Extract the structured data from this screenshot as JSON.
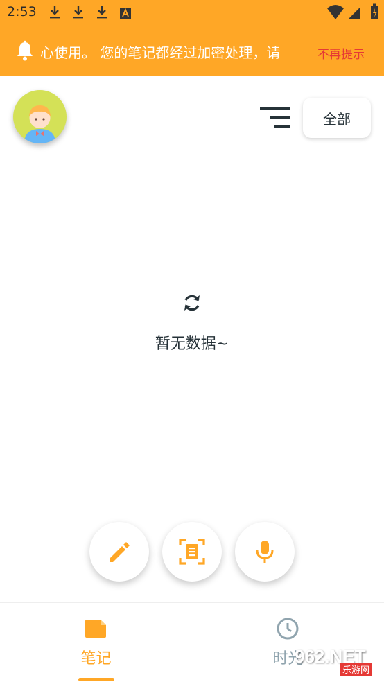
{
  "status_bar": {
    "time": "2:53",
    "icons": [
      "download-icon",
      "download-icon",
      "download-icon",
      "text-badge-icon",
      "wifi-icon",
      "signal-icon",
      "battery-icon"
    ]
  },
  "notice": {
    "text": "心使用。 您的笔记都经过加密处理，请",
    "dismiss": "不再提示",
    "icon": "bell-icon"
  },
  "header": {
    "avatar": "avatar",
    "menu_icon": "menu-icon",
    "filter_label": "全部"
  },
  "empty_state": {
    "icon": "refresh-icon",
    "text": "暂无数据~"
  },
  "fabs": [
    {
      "name": "edit",
      "icon": "pencil-icon"
    },
    {
      "name": "scan",
      "icon": "scan-icon"
    },
    {
      "name": "voice",
      "icon": "microphone-icon"
    }
  ],
  "bottom_nav": {
    "items": [
      {
        "label": "笔记",
        "icon": "note-icon",
        "active": true
      },
      {
        "label": "时光",
        "icon": "clock-icon",
        "active": false
      }
    ]
  },
  "watermark": {
    "main": "962.NET",
    "sub": "乐游网"
  },
  "colors": {
    "accent": "#FFA726",
    "dismiss": "#E53935",
    "text_dark": "#263238",
    "inactive": "#90A4AE"
  }
}
